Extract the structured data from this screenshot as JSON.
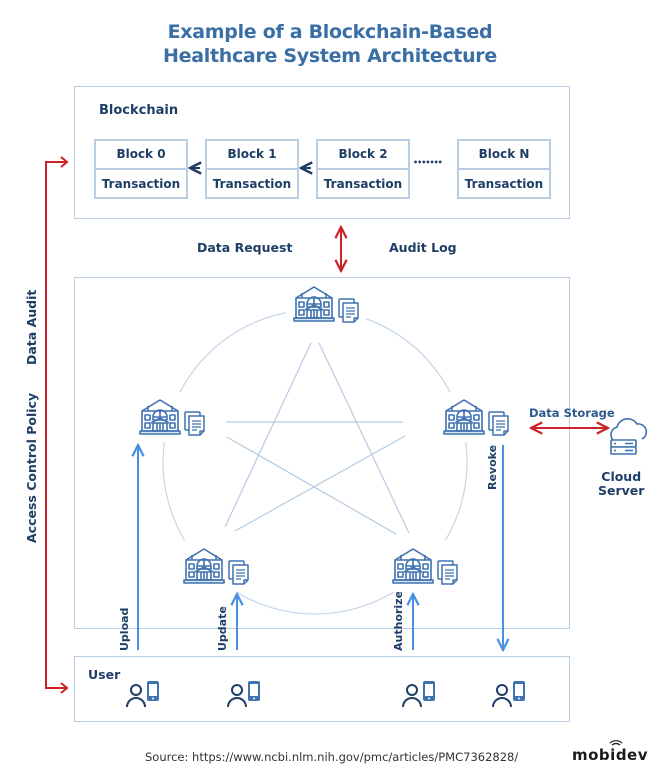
{
  "title": [
    "Example of a Blockchain-Based",
    "Healthcare System Architecture"
  ],
  "blockchain": {
    "label": "Blockchain",
    "blocks": [
      {
        "name": "Block 0",
        "content": "Transaction"
      },
      {
        "name": "Block 1",
        "content": "Transaction"
      },
      {
        "name": "Block 2",
        "content": "Transaction"
      },
      {
        "name": "Block N",
        "content": "Transaction"
      }
    ],
    "ellipsis": "•••••••"
  },
  "links": {
    "data_request": "Data Request",
    "audit_log": "Audit Log",
    "data_audit": "Data Audit",
    "access_control_policy": "Access Control Policy",
    "data_storage": "Data Storage"
  },
  "network": {
    "nodes": [
      "hospital-top",
      "hospital-left",
      "hospital-right",
      "hospital-bottom-left",
      "hospital-bottom-right"
    ],
    "actions": [
      "Upload",
      "Update",
      "Authorize",
      "Revoke"
    ]
  },
  "cloud": {
    "label_line1": "Cloud",
    "label_line2": "Server"
  },
  "user": {
    "label": "User",
    "count": 4
  },
  "footer": {
    "source": "Source: https://www.ncbi.nlm.nih.gov/pmc/articles/PMC7362828/",
    "logo": "mobidev"
  },
  "colors": {
    "title": "#3a6ea5",
    "text": "#1f3e66",
    "border": "#b9cde3",
    "icon": "#3f72b0",
    "red_arrow": "#cc2229",
    "blue_arrow": "#4a90e2"
  }
}
